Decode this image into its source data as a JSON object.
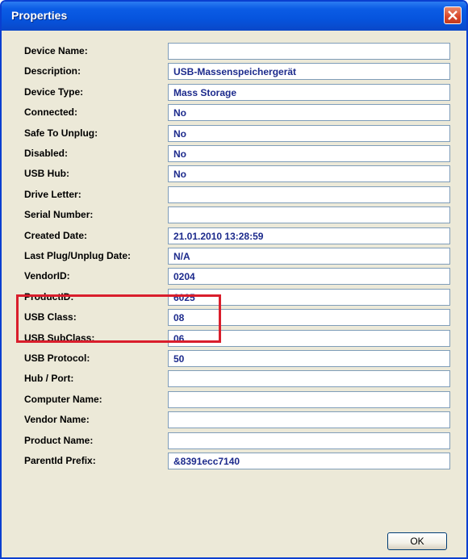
{
  "window": {
    "title": "Properties"
  },
  "properties": [
    {
      "label": "Device Name:",
      "value": ""
    },
    {
      "label": "Description:",
      "value": "USB-Massenspeichergerät"
    },
    {
      "label": "Device Type:",
      "value": "Mass Storage"
    },
    {
      "label": "Connected:",
      "value": "No"
    },
    {
      "label": "Safe To Unplug:",
      "value": "No"
    },
    {
      "label": "Disabled:",
      "value": "No"
    },
    {
      "label": "USB Hub:",
      "value": "No"
    },
    {
      "label": "Drive Letter:",
      "value": ""
    },
    {
      "label": "Serial Number:",
      "value": ""
    },
    {
      "label": "Created Date:",
      "value": "21.01.2010 13:28:59"
    },
    {
      "label": "Last Plug/Unplug Date:",
      "value": "N/A"
    },
    {
      "label": "VendorID:",
      "value": "0204"
    },
    {
      "label": "ProductID:",
      "value": "6025"
    },
    {
      "label": "USB Class:",
      "value": "08"
    },
    {
      "label": "USB SubClass:",
      "value": "06"
    },
    {
      "label": "USB Protocol:",
      "value": "50"
    },
    {
      "label": "Hub / Port:",
      "value": ""
    },
    {
      "label": "Computer Name:",
      "value": ""
    },
    {
      "label": "Vendor Name:",
      "value": ""
    },
    {
      "label": "Product Name:",
      "value": ""
    },
    {
      "label": "ParentId Prefix:",
      "value": "&8391ecc7140"
    }
  ],
  "buttons": {
    "ok_label": "OK"
  },
  "colors": {
    "title_bar": "#0654dd",
    "highlight": "#d91e2c",
    "value_text": "#1c2a8c"
  }
}
